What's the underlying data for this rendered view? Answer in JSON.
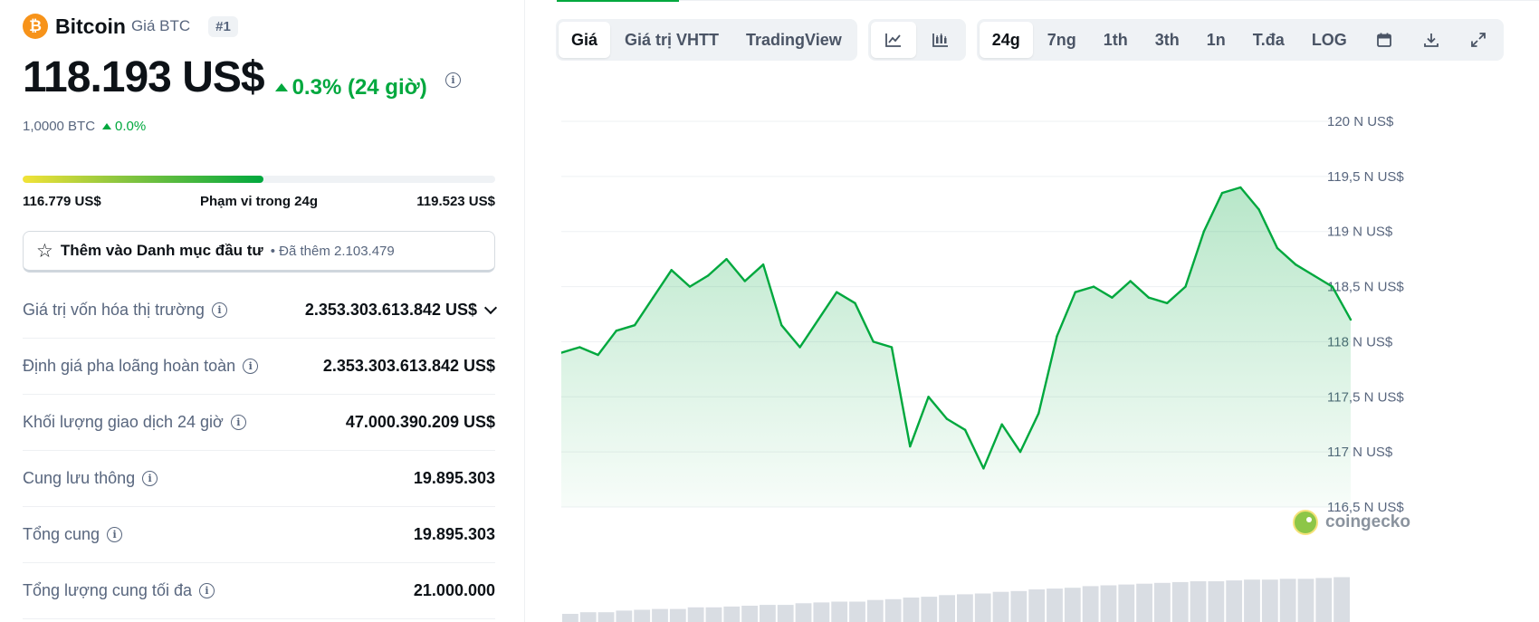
{
  "coin": {
    "logo_glyph": "₿",
    "name": "Bitcoin",
    "symbol_label": "Giá BTC",
    "rank": "#1",
    "price": "118.193 US$",
    "change_24h": "0.3% (24 giờ)",
    "btc_price": "1,0000 BTC",
    "btc_change": "0.0%"
  },
  "range_24h": {
    "low": "116.779 US$",
    "label": "Phạm vi trong 24g",
    "high": "119.523 US$",
    "position_fraction": 0.51
  },
  "watchlist": {
    "label": "Thêm vào Danh mục đầu tư",
    "added_text": "• Đã thêm 2.103.479"
  },
  "stats": [
    {
      "label": "Giá trị vốn hóa thị trường",
      "value": "2.353.303.613.842 US$",
      "expandable": true
    },
    {
      "label": "Định giá pha loãng hoàn toàn",
      "value": "2.353.303.613.842 US$",
      "expandable": false
    },
    {
      "label": "Khối lượng giao dịch 24 giờ",
      "value": "47.000.390.209 US$",
      "expandable": false
    },
    {
      "label": "Cung lưu thông",
      "value": "19.895.303",
      "expandable": false
    },
    {
      "label": "Tổng cung",
      "value": "19.895.303",
      "expandable": false
    },
    {
      "label": "Tổng lượng cung tối đa",
      "value": "21.000.000",
      "expandable": false
    }
  ],
  "toolbar": {
    "view_tabs": [
      {
        "label": "Giá",
        "active": true
      },
      {
        "label": "Giá trị VHTT",
        "active": false
      },
      {
        "label": "TradingView",
        "active": false
      }
    ],
    "chart_types": [
      {
        "icon": "line-chart-icon",
        "active": true
      },
      {
        "icon": "candlestick-chart-icon",
        "active": false
      }
    ],
    "ranges": [
      {
        "label": "24g",
        "active": true
      },
      {
        "label": "7ng",
        "active": false
      },
      {
        "label": "1th",
        "active": false
      },
      {
        "label": "3th",
        "active": false
      },
      {
        "label": "1n",
        "active": false
      },
      {
        "label": "T.đa",
        "active": false
      },
      {
        "label": "LOG",
        "active": false
      }
    ],
    "tool_icons": [
      "calendar-icon",
      "download-icon",
      "expand-icon"
    ]
  },
  "watermark": "coingecko",
  "colors": {
    "up": "#00a83e",
    "bitcoin": "#f7931a",
    "text_primary": "#0d1217",
    "text_muted": "#58667e"
  },
  "chart_data": {
    "type": "area",
    "title": "",
    "xlabel": "",
    "ylabel": "",
    "ylim": [
      116500,
      120000
    ],
    "yticks": [
      120000,
      119500,
      119000,
      118500,
      118000,
      117500,
      117000,
      116500
    ],
    "ytick_labels": [
      "120 N US$",
      "119,5 N US$",
      "119 N US$",
      "118,5 N US$",
      "118 N US$",
      "117,5 N US$",
      "117 N US$",
      "116,5 N US$"
    ],
    "grid": true,
    "series": [
      {
        "values": [
          117900,
          117950,
          117880,
          118100,
          118150,
          118400,
          118650,
          118500,
          118600,
          118750,
          118550,
          118700,
          118150,
          117950,
          118200,
          118450,
          118350,
          118000,
          117950,
          117050,
          117500,
          117300,
          117200,
          116850,
          117250,
          117000,
          117350,
          118050,
          118450,
          118500,
          118400,
          118550,
          118400,
          118350,
          118500,
          119000,
          119350,
          119400,
          119200,
          118850,
          118700,
          118600,
          118500,
          118200
        ]
      }
    ],
    "volume": [
      10,
      12,
      12,
      14,
      15,
      16,
      16,
      18,
      18,
      19,
      20,
      21,
      21,
      23,
      24,
      25,
      25,
      27,
      28,
      30,
      31,
      33,
      34,
      35,
      37,
      38,
      40,
      41,
      42,
      44,
      45,
      46,
      47,
      48,
      49,
      50,
      50,
      51,
      52,
      52,
      53,
      53,
      54,
      55
    ]
  }
}
